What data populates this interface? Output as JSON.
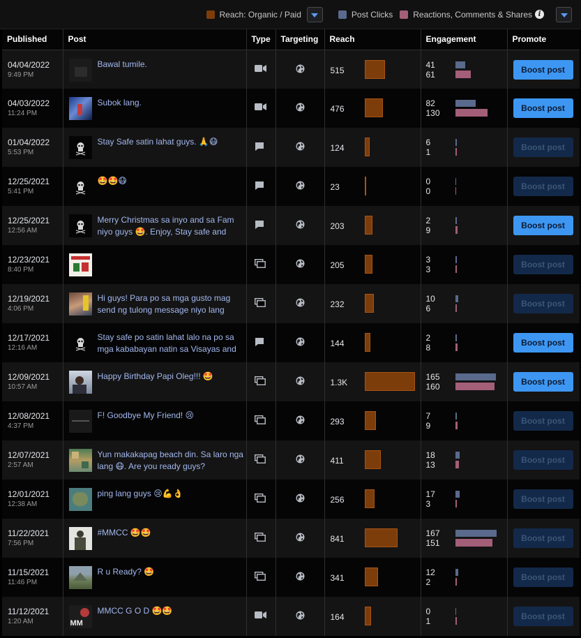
{
  "legend": {
    "organic_label": "Reach: Organic / Paid",
    "clicks_label": "Post Clicks",
    "reactions_label": "Reactions, Comments & Shares",
    "info_glyph": "i",
    "colors": {
      "reach": "#7d3d0b",
      "clicks": "#5a6a8c",
      "reactions": "#a35e78"
    }
  },
  "headers": {
    "published": "Published",
    "post": "Post",
    "type": "Type",
    "targeting": "Targeting",
    "reach": "Reach",
    "engagement": "Engagement",
    "promote": "Promote"
  },
  "max_reach": 1300,
  "max_engagement": 170,
  "rows": [
    {
      "date": "04/04/2022",
      "time": "9:49 PM",
      "text": "Bawal tumile.",
      "type": "video",
      "reach": "515",
      "reach_value": 515,
      "clicks": "41",
      "reactions": "61",
      "clicks_value": 41,
      "reactions_value": 61,
      "boost": "Boost post",
      "boost_enabled": true,
      "thumb": "dark"
    },
    {
      "date": "04/03/2022",
      "time": "11:24 PM",
      "text": "Subok lang.",
      "type": "video",
      "reach": "476",
      "reach_value": 476,
      "clicks": "82",
      "reactions": "130",
      "clicks_value": 82,
      "reactions_value": 130,
      "boost": "Boost post",
      "boost_enabled": true,
      "thumb": "blue"
    },
    {
      "date": "01/04/2022",
      "time": "5:53 PM",
      "text": "Stay Safe satin lahat guys. 🙏😷",
      "type": "status",
      "reach": "124",
      "reach_value": 124,
      "clicks": "6",
      "reactions": "1",
      "clicks_value": 6,
      "reactions_value": 1,
      "boost": "Boost post",
      "boost_enabled": false,
      "thumb": "skull"
    },
    {
      "date": "12/25/2021",
      "time": "5:41 PM",
      "text": "🤩🤩😷",
      "type": "status",
      "reach": "23",
      "reach_value": 23,
      "clicks": "0",
      "reactions": "0",
      "clicks_value": 0,
      "reactions_value": 0,
      "boost": "Boost post",
      "boost_enabled": false,
      "thumb": "skull"
    },
    {
      "date": "12/25/2021",
      "time": "12:56 AM",
      "text": "Merry Christmas sa inyo and sa Fam niyo guys 🤩. Enjoy, Stay safe and",
      "type": "status",
      "reach": "203",
      "reach_value": 203,
      "clicks": "2",
      "reactions": "9",
      "clicks_value": 2,
      "reactions_value": 9,
      "boost": "Boost post",
      "boost_enabled": true,
      "thumb": "skull"
    },
    {
      "date": "12/23/2021",
      "time": "8:40 PM",
      "text": "",
      "type": "album",
      "reach": "205",
      "reach_value": 205,
      "clicks": "3",
      "reactions": "3",
      "clicks_value": 3,
      "reactions_value": 3,
      "boost": "Boost post",
      "boost_enabled": false,
      "thumb": "xmas"
    },
    {
      "date": "12/19/2021",
      "time": "4:06 PM",
      "text": "Hi guys! Para po sa mga gusto mag send ng tulong message niyo lang",
      "type": "album",
      "reach": "232",
      "reach_value": 232,
      "clicks": "10",
      "reactions": "6",
      "clicks_value": 10,
      "reactions_value": 6,
      "boost": "Boost post",
      "boost_enabled": false,
      "thumb": "crowd"
    },
    {
      "date": "12/17/2021",
      "time": "12:16 AM",
      "text": "Stay safe po satin lahat lalo na po sa mga kababayan natin sa Visayas and",
      "type": "status",
      "reach": "144",
      "reach_value": 144,
      "clicks": "2",
      "reactions": "8",
      "clicks_value": 2,
      "reactions_value": 8,
      "boost": "Boost post",
      "boost_enabled": true,
      "thumb": "skull"
    },
    {
      "date": "12/09/2021",
      "time": "10:57 AM",
      "text": "Happy Birthday Papi Oleg!!! 🤩",
      "type": "album",
      "reach": "1.3K",
      "reach_value": 1300,
      "clicks": "165",
      "reactions": "160",
      "clicks_value": 165,
      "reactions_value": 160,
      "boost": "Boost post",
      "boost_enabled": true,
      "thumb": "person"
    },
    {
      "date": "12/08/2021",
      "time": "4:37 PM",
      "text": "F! Goodbye My Friend! 😢",
      "type": "album",
      "reach": "293",
      "reach_value": 293,
      "clicks": "7",
      "reactions": "9",
      "clicks_value": 7,
      "reactions_value": 9,
      "boost": "Boost post",
      "boost_enabled": false,
      "thumb": "darkgray"
    },
    {
      "date": "12/07/2021",
      "time": "2:57 AM",
      "text": "Yun makakapag beach din. Sa laro nga lang 😷. Are you ready guys?",
      "type": "album",
      "reach": "411",
      "reach_value": 411,
      "clicks": "18",
      "reactions": "13",
      "clicks_value": 18,
      "reactions_value": 13,
      "boost": "Boost post",
      "boost_enabled": false,
      "thumb": "beach"
    },
    {
      "date": "12/01/2021",
      "time": "12:38 AM",
      "text": "ping lang guys 😢💪👌",
      "type": "album",
      "reach": "256",
      "reach_value": 256,
      "clicks": "17",
      "reactions": "3",
      "clicks_value": 17,
      "reactions_value": 3,
      "boost": "Boost post",
      "boost_enabled": false,
      "thumb": "map"
    },
    {
      "date": "11/22/2021",
      "time": "7:56 PM",
      "text": "#MMCC 🤩🤩",
      "type": "album",
      "reach": "841",
      "reach_value": 841,
      "clicks": "167",
      "reactions": "151",
      "clicks_value": 167,
      "reactions_value": 151,
      "boost": "Boost post",
      "boost_enabled": false,
      "thumb": "soldier"
    },
    {
      "date": "11/15/2021",
      "time": "11:46 PM",
      "text": "R u Ready? 🤩",
      "type": "album",
      "reach": "341",
      "reach_value": 341,
      "clicks": "12",
      "reactions": "2",
      "clicks_value": 12,
      "reactions_value": 2,
      "boost": "Boost post",
      "boost_enabled": false,
      "thumb": "landscape"
    },
    {
      "date": "11/12/2021",
      "time": "1:20 AM",
      "text": "MMCC G O D 🤩🤩",
      "type": "video",
      "reach": "164",
      "reach_value": 164,
      "clicks": "0",
      "reactions": "1",
      "clicks_value": 0,
      "reactions_value": 1,
      "boost": "Boost post",
      "boost_enabled": false,
      "thumb": "mm"
    }
  ]
}
